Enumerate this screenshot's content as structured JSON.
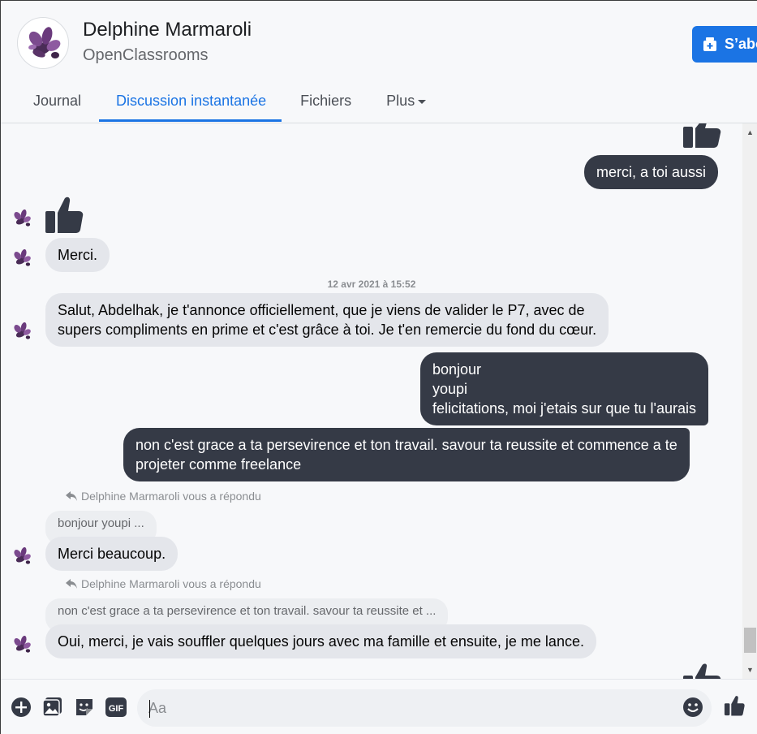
{
  "header": {
    "name": "Delphine Marmaroli",
    "group": "OpenClassrooms",
    "subscribe_label": "S’abonner",
    "tabs": [
      {
        "label": "Journal"
      },
      {
        "label": "Discussion instantanée"
      },
      {
        "label": "Fichiers"
      },
      {
        "label": "Plus"
      }
    ]
  },
  "messages": {
    "m1": "merci, a toi aussi",
    "m2": "Merci.",
    "timestamp": "12 avr 2021 à 15:52",
    "m3_line1": "Salut, Abdelhak, je t'annonce officiellement, que je viens de valider le P7, avec de",
    "m3_line2": "supers compliments en prime et c'est grâce à toi. Je t'en remercie du fond du cœur.",
    "m4_line1": "bonjour",
    "m4_line2": "youpi",
    "m4_line3": "felicitations, moi j'etais sur que tu l'aurais",
    "m5_line1": "non c'est grace a ta persevirence et ton travail. savour ta reussite et commence a te",
    "m5_line2": "projeter comme freelance",
    "reply_note": "Delphine Marmaroli vous a répondu",
    "q1": "bonjour youpi ...",
    "m6": "Merci beaucoup.",
    "q2": "non c'est grace a ta persevirence et ton travail. savour ta reussite et ...",
    "m7": "Oui, merci, je vais souffler quelques jours avec ma famille et ensuite, je me lance."
  },
  "composer": {
    "placeholder": "Aa",
    "icons": [
      "plus-circle-icon",
      "image-icon",
      "sticker-icon",
      "gif-icon",
      "emoji-icon",
      "thumbs-up-icon"
    ],
    "gif_label": "GIF"
  },
  "colors": {
    "accent": "#1b74e4",
    "outgoing_bubble": "#353a46",
    "incoming_bubble": "#e4e6eb"
  }
}
